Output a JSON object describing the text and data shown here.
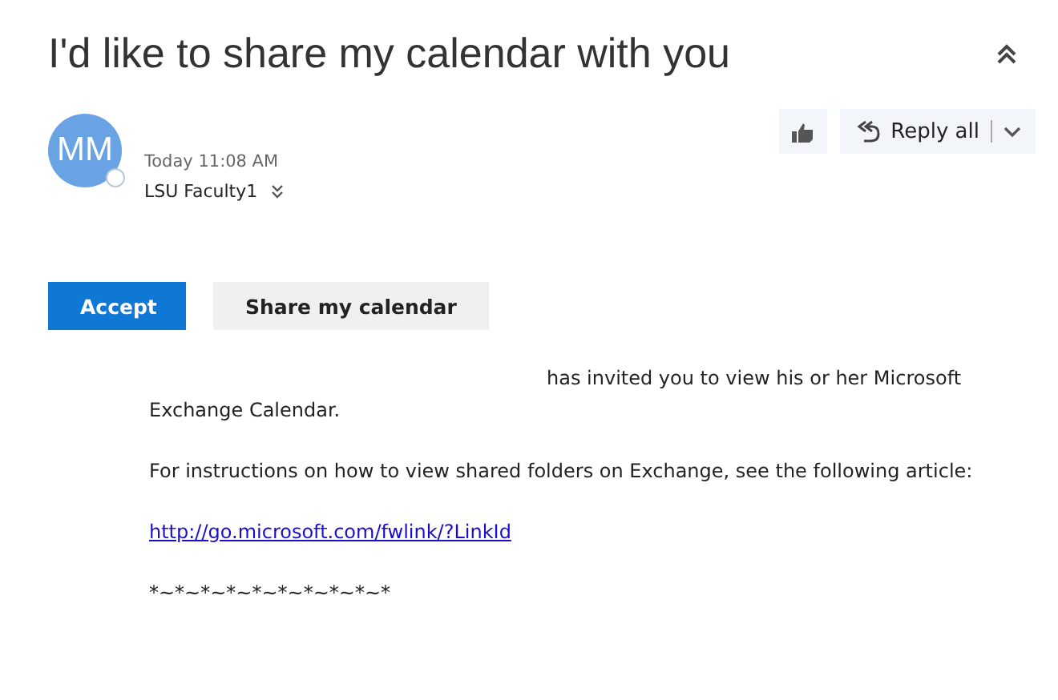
{
  "subject": "I'd like to share my calendar with you",
  "sender": {
    "initials": "MM",
    "time": "Today 11:08 AM",
    "recipient": "LSU Faculty1"
  },
  "actions": {
    "reply_label": "Reply all"
  },
  "buttons": [
    {
      "label": "Accept",
      "kind": "primary"
    },
    {
      "label": "Share my calendar",
      "kind": "secondary"
    }
  ],
  "body": {
    "intro": "has invited you to view his or her Microsoft Exchange Calendar.",
    "instructions": "For instructions on how to view shared folders on Exchange, see the following article:",
    "link": "http://go.microsoft.com/fwlink/?LinkId",
    "signature": "*~*~*~*~*~*~*~*~*~*"
  }
}
